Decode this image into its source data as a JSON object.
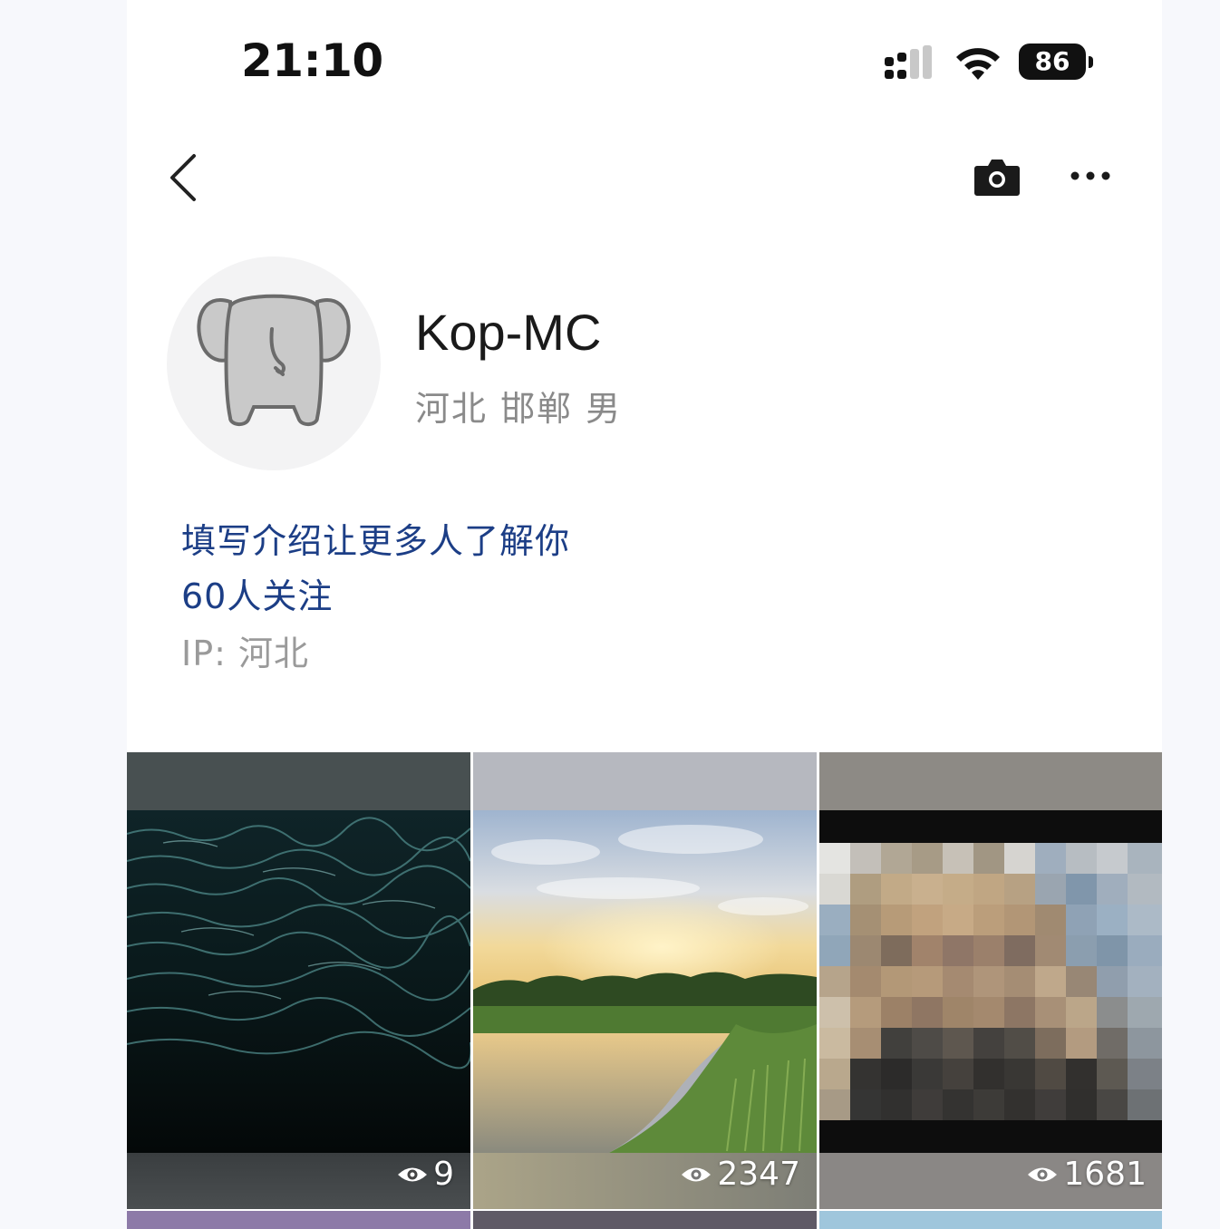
{
  "status_bar": {
    "time": "21:10",
    "battery": "86",
    "icons": [
      "signal-icon",
      "wifi-icon",
      "battery-icon"
    ]
  },
  "nav": {
    "icons": [
      "back-icon",
      "camera-icon",
      "more-icon"
    ]
  },
  "profile": {
    "username": "Kop-MC",
    "meta": "河北 邯郸 男",
    "bio_prompt": "填写介绍让更多人了解你",
    "followers": "60人关注",
    "ip": "IP: 河北"
  },
  "posts": [
    {
      "views": "9",
      "icon": "eye-icon"
    },
    {
      "views": "2347",
      "icon": "eye-icon"
    },
    {
      "views": "1681",
      "icon": "eye-icon"
    }
  ],
  "colors": {
    "link": "#1c3e86",
    "muted": "#8a8a8a",
    "background": "#ffffff"
  }
}
